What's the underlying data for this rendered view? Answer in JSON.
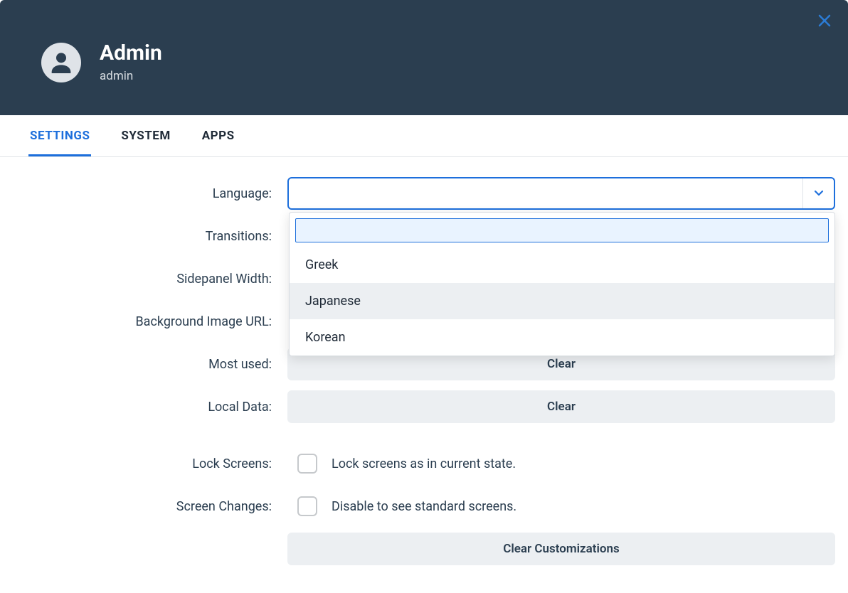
{
  "header": {
    "name": "Admin",
    "username": "admin"
  },
  "tabs": {
    "settings": "SETTINGS",
    "system": "SYSTEM",
    "apps": "APPS"
  },
  "labels": {
    "language": "Language:",
    "transitions": "Transitions:",
    "sidepanelWidth": "Sidepanel Width:",
    "backgroundImageUrl": "Background Image URL:",
    "mostUsed": "Most used:",
    "localData": "Local Data:",
    "lockScreens": "Lock Screens:",
    "screenChanges": "Screen Changes:"
  },
  "languageSelect": {
    "value": "",
    "options": [
      "Greek",
      "Japanese",
      "Korean"
    ],
    "filter": ""
  },
  "buttons": {
    "clearMostUsed": "Clear",
    "clearLocalData": "Clear",
    "clearCustomizations": "Clear Customizations"
  },
  "captions": {
    "lockScreens": "Lock screens as in current state.",
    "screenChanges": "Disable to see standard screens."
  }
}
